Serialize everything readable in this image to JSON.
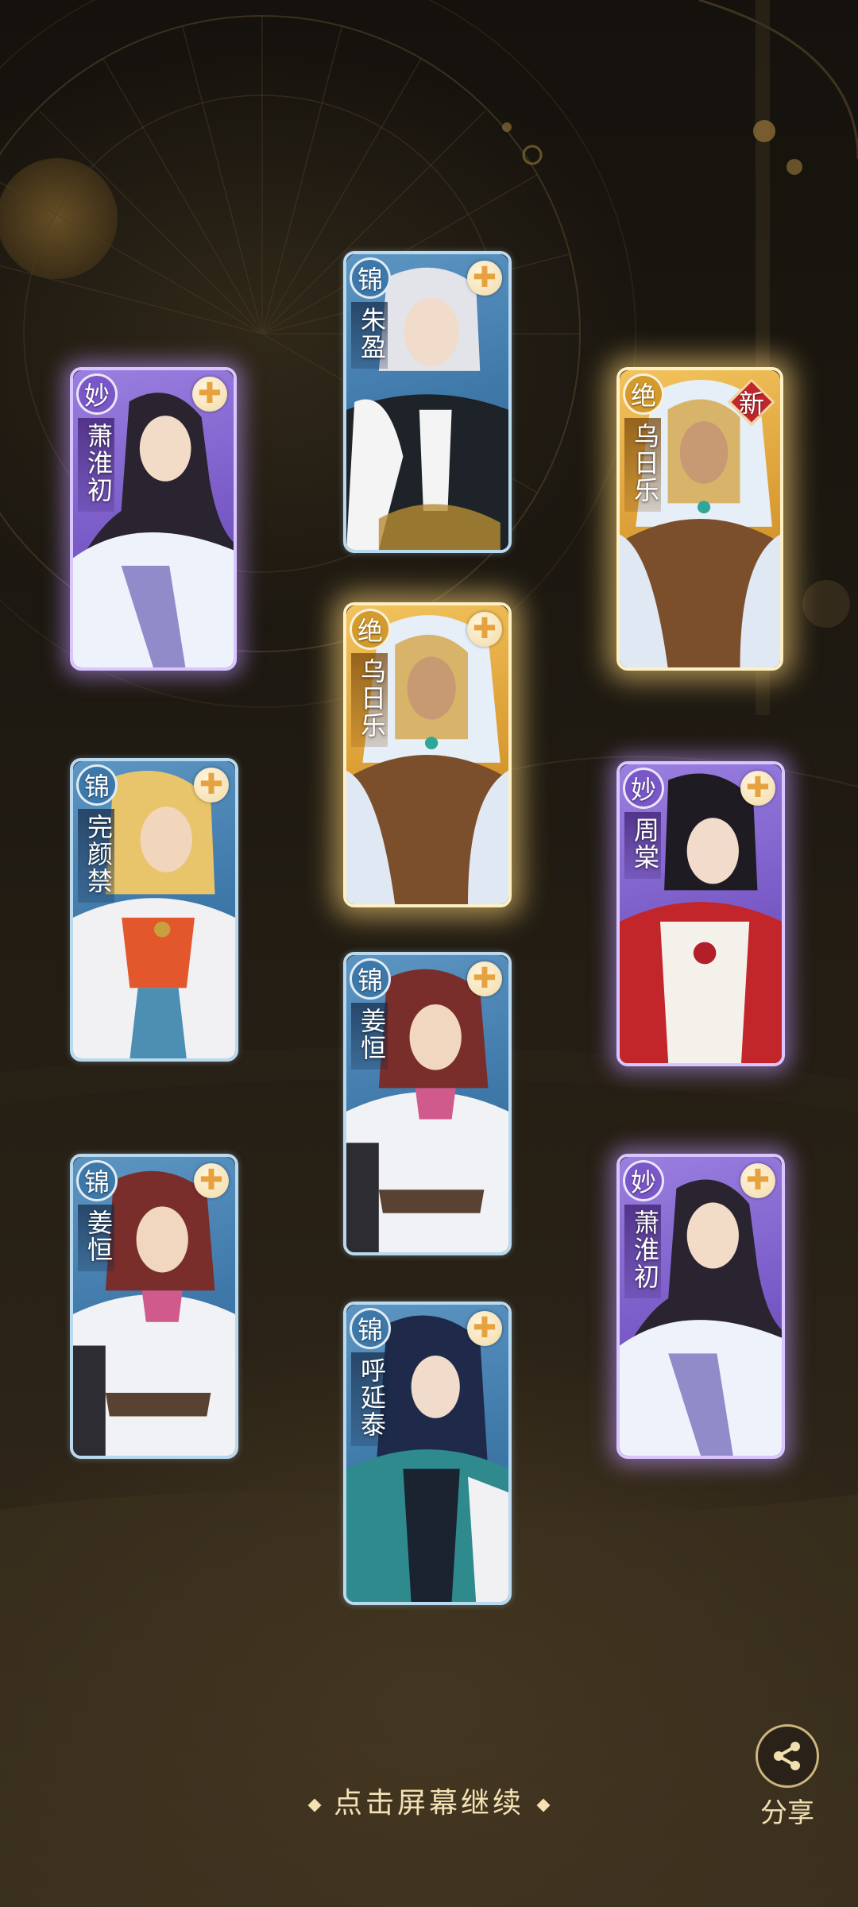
{
  "hint": {
    "text": "点击屏幕继续"
  },
  "share": {
    "label": "分享"
  },
  "rarity_colors": {
    "锦": "#3c78aa",
    "妙": "#7a57c9",
    "绝": "#d39a2c"
  },
  "cards": [
    {
      "rarity": "妙",
      "name": "萧淮初",
      "is_new": false,
      "style": "miao"
    },
    {
      "rarity": "锦",
      "name": "朱盈",
      "is_new": false,
      "style": "jin"
    },
    {
      "rarity": "绝",
      "name": "乌日乐",
      "is_new": true,
      "new_label": "新",
      "style": "jue"
    },
    {
      "rarity": "绝",
      "name": "乌日乐",
      "is_new": false,
      "style": "jue"
    },
    {
      "rarity": "锦",
      "name": "完颜禁",
      "is_new": false,
      "style": "jin"
    },
    {
      "rarity": "妙",
      "name": "周棠",
      "is_new": false,
      "style": "miao"
    },
    {
      "rarity": "锦",
      "name": "姜恒",
      "is_new": false,
      "style": "jin"
    },
    {
      "rarity": "锦",
      "name": "姜恒",
      "is_new": false,
      "style": "jin"
    },
    {
      "rarity": "妙",
      "name": "萧淮初",
      "is_new": false,
      "style": "miao"
    },
    {
      "rarity": "锦",
      "name": "呼延泰",
      "is_new": false,
      "style": "jin"
    }
  ]
}
